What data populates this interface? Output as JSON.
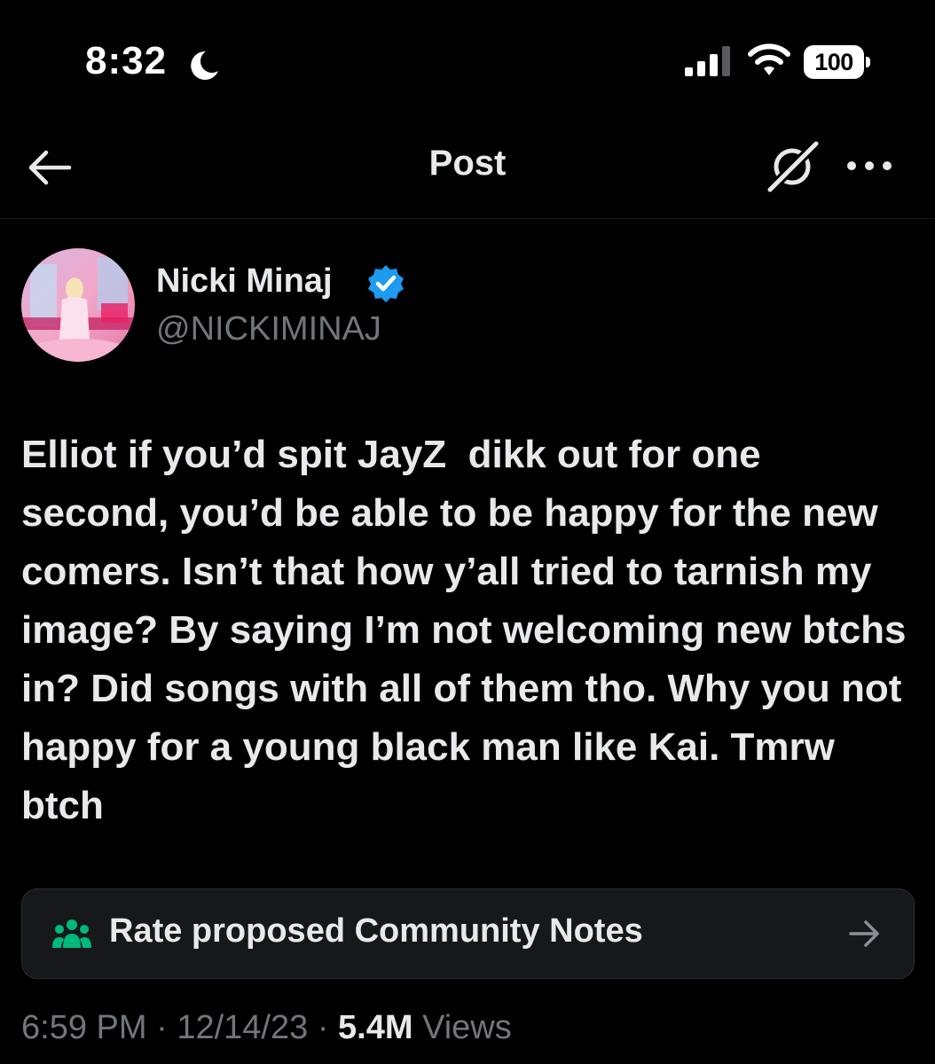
{
  "status_bar": {
    "time": "8:32",
    "battery": "100",
    "icons": [
      "moon-icon",
      "signal-icon",
      "wifi-icon",
      "battery-icon"
    ]
  },
  "header": {
    "title": "Post",
    "icons": [
      "back-arrow-icon",
      "mute-icon",
      "more-icon"
    ]
  },
  "author": {
    "name": "Nicki Minaj",
    "handle": "@NICKIMINAJ",
    "verified": true,
    "verified_color": "#1d9bf0"
  },
  "post": {
    "text": "Elliot if you’d spit JayZ  dikk out for one second, you’d be able to be happy for the new comers. Isn’t that how y’all tried to tarnish my image? By saying I’m not welcoming new btchs in? Did songs with all of them tho. Why you not happy for a young black man like Kai. Tmrw btch"
  },
  "community_notes": {
    "label": "Rate proposed Community Notes",
    "icon_color": "#00ba7c"
  },
  "meta": {
    "time": "6:59 PM",
    "separator": "·",
    "date": "12/14/23",
    "views_count": "5.4M",
    "views_label": "Views"
  },
  "colors": {
    "background": "#000000",
    "text_primary": "#e7e9ea",
    "text_secondary": "#71767b",
    "card_background": "#16181c"
  }
}
